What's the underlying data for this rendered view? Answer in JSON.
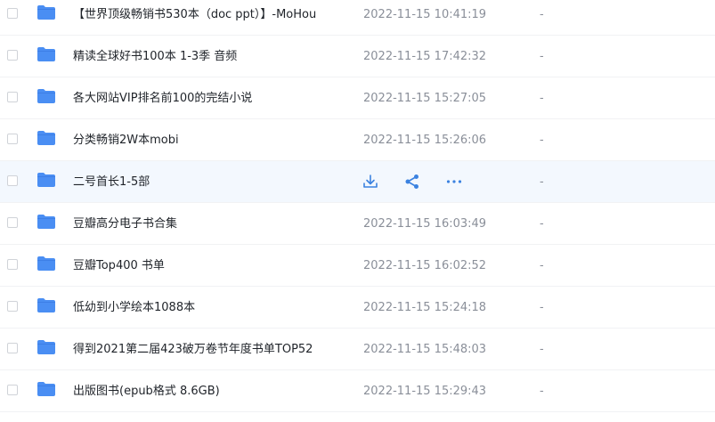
{
  "colors": {
    "folder": "#4a8ef3",
    "folder_tab": "#3d7fe6",
    "action_icon": "#3b82e0",
    "hover_row": "#f3f8fe"
  },
  "files": [
    {
      "name": "【世界顶级畅销书530本（doc ppt）】-MoHou",
      "time": "2022-11-15 10:41:19",
      "size": "-"
    },
    {
      "name": "精读全球好书100本 1-3季 音频",
      "time": "2022-11-15 17:42:32",
      "size": "-"
    },
    {
      "name": "各大网站VIP排名前100的完结小说",
      "time": "2022-11-15 15:27:05",
      "size": "-"
    },
    {
      "name": "分类畅销2W本mobi",
      "time": "2022-11-15 15:26:06",
      "size": "-"
    },
    {
      "name": "二号首长1-5部",
      "time": "",
      "size": "-"
    },
    {
      "name": "豆瓣高分电子书合集",
      "time": "2022-11-15 16:03:49",
      "size": "-"
    },
    {
      "name": "豆瓣Top400 书单",
      "time": "2022-11-15 16:02:52",
      "size": "-"
    },
    {
      "name": "低幼到小学绘本1088本",
      "time": "2022-11-15 15:24:18",
      "size": "-"
    },
    {
      "name": "得到2021第二届423破万卷节年度书单TOP52",
      "time": "2022-11-15 15:48:03",
      "size": "-"
    },
    {
      "name": "出版图书(epub格式 8.6GB)",
      "time": "2022-11-15 15:29:43",
      "size": "-"
    }
  ],
  "hover_actions": [
    "download-icon",
    "share-icon",
    "more-icon"
  ]
}
